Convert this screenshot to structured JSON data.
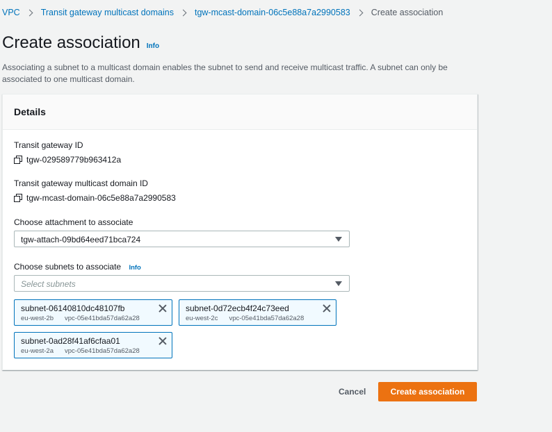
{
  "breadcrumb": {
    "items": [
      "VPC",
      "Transit gateway multicast domains",
      "tgw-mcast-domain-06c5e88a7a2990583"
    ],
    "current": "Create association"
  },
  "page": {
    "title": "Create association",
    "info": "Info",
    "description": "Associating a subnet to a multicast domain enables the subnet to send and receive multicast traffic. A subnet can only be associated to one multicast domain."
  },
  "details": {
    "header": "Details",
    "tgw_id_label": "Transit gateway ID",
    "tgw_id_value": "tgw-029589779b963412a",
    "domain_id_label": "Transit gateway multicast domain ID",
    "domain_id_value": "tgw-mcast-domain-06c5e88a7a2990583",
    "attachment_label": "Choose attachment to associate",
    "attachment_value": "tgw-attach-09bd64eed71bca724",
    "subnets_label": "Choose subnets to associate",
    "subnets_info": "Info",
    "subnets_placeholder": "Select subnets",
    "tokens": [
      {
        "name": "subnet-06140810dc48107fb",
        "az": "eu-west-2b",
        "vpc": "vpc-05e41bda57da62a28"
      },
      {
        "name": "subnet-0d72ecb4f24c73eed",
        "az": "eu-west-2c",
        "vpc": "vpc-05e41bda57da62a28"
      },
      {
        "name": "subnet-0ad28f41af6cfaa01",
        "az": "eu-west-2a",
        "vpc": "vpc-05e41bda57da62a28"
      }
    ]
  },
  "actions": {
    "cancel": "Cancel",
    "submit": "Create association"
  },
  "colors": {
    "primary": "#ec7211",
    "link": "#0073bb",
    "token_border": "#0073bb",
    "token_bg": "#f1faff"
  }
}
